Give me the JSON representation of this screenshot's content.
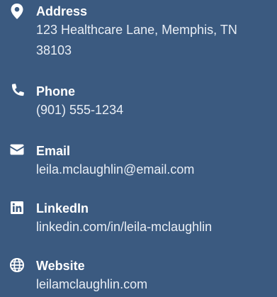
{
  "contact": {
    "items": [
      {
        "icon": "map-pin-icon",
        "label": "Address",
        "value": "123 Healthcare Lane, Memphis, TN 38103"
      },
      {
        "icon": "phone-icon",
        "label": "Phone",
        "value": "(901) 555-1234"
      },
      {
        "icon": "envelope-icon",
        "label": "Email",
        "value": "leila.mclaughlin@email.com"
      },
      {
        "icon": "linkedin-icon",
        "label": "LinkedIn",
        "value": "linkedin.com/in/leila-mclaughlin"
      },
      {
        "icon": "globe-icon",
        "label": "Website",
        "value": "leilamclaughlin.com"
      }
    ]
  },
  "colors": {
    "background": "#3b5a80",
    "text": "#ffffff"
  }
}
